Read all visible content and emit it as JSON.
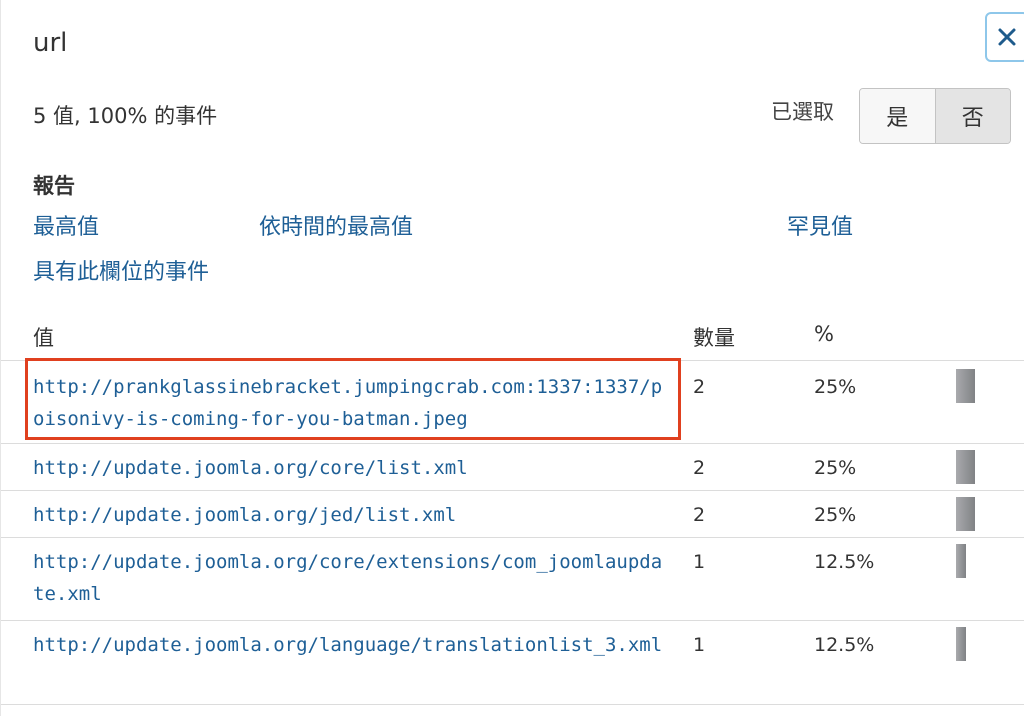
{
  "header": {
    "field_name": "url",
    "close_label": "×"
  },
  "summary": {
    "text": "5 值, 100% 的事件",
    "selected_label": "已選取",
    "toggle_yes": "是",
    "toggle_no": "否",
    "toggle_selected": "否"
  },
  "reports": {
    "heading": "報告",
    "links": {
      "top_values": "最高值",
      "top_values_by_time": "依時間的最高值",
      "rare_values": "罕見值",
      "events_with_field": "具有此欄位的事件"
    }
  },
  "table": {
    "headers": {
      "value": "值",
      "count": "數量",
      "percent": "%"
    },
    "rows": [
      {
        "value": "http://prankglassinebracket.jumpingcrab.com:1337:1337/poisonivy-is-coming-for-you-batman.jpeg",
        "count": "2",
        "percent": "25%",
        "fraction": 0.25
      },
      {
        "value": "http://update.joomla.org/core/list.xml",
        "count": "2",
        "percent": "25%",
        "fraction": 0.25
      },
      {
        "value": "http://update.joomla.org/jed/list.xml",
        "count": "2",
        "percent": "25%",
        "fraction": 0.25
      },
      {
        "value": "http://update.joomla.org/core/extensions/com_joomlaupdate.xml",
        "count": "1",
        "percent": "12.5%",
        "fraction": 0.125
      },
      {
        "value": "http://update.joomla.org/language/translationlist_3.xml",
        "count": "1",
        "percent": "12.5%",
        "fraction": 0.125
      }
    ]
  },
  "colors": {
    "link": "#1e5f96",
    "highlight": "#e0401f",
    "bar": "#8c8d90"
  },
  "icons": {
    "close": "close-icon"
  }
}
